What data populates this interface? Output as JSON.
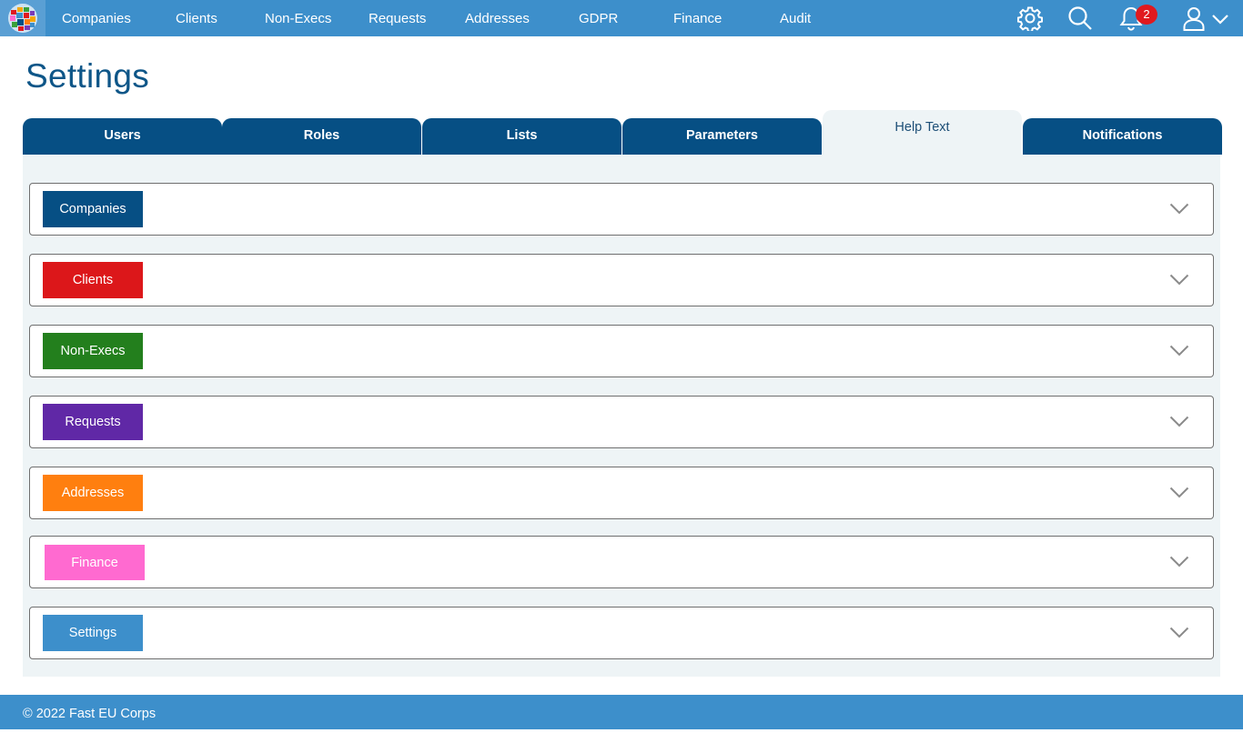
{
  "nav": {
    "items": [
      "Companies",
      "Clients",
      "Non-Execs",
      "Requests",
      "Addresses",
      "GDPR",
      "Finance",
      "Audit"
    ],
    "notification_count": "2"
  },
  "page": {
    "title": "Settings"
  },
  "tabs": [
    "Users",
    "Roles",
    "Lists",
    "Parameters",
    "Help Text",
    "Notifications"
  ],
  "active_tab": "Help Text",
  "sections": [
    {
      "label": "Companies",
      "color": "#064f84"
    },
    {
      "label": "Clients",
      "color": "#dc171a"
    },
    {
      "label": "Non-Execs",
      "color": "#237f1d"
    },
    {
      "label": "Requests",
      "color": "#6028a6"
    },
    {
      "label": "Addresses",
      "color": "#ff7f0f"
    },
    {
      "label": "Finance",
      "color": "#ff6ad0"
    },
    {
      "label": "Settings",
      "color": "#3d8fcb"
    }
  ],
  "footer": {
    "copyright": "© 2022 Fast EU Corps"
  }
}
